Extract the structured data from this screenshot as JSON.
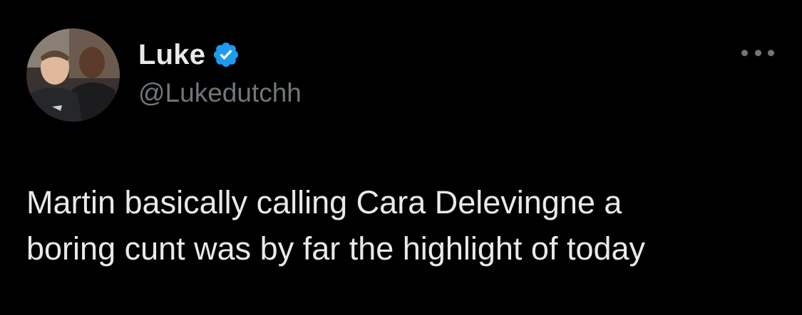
{
  "tweet": {
    "author": {
      "display_name": "Luke",
      "handle": "@Lukedutchh",
      "verified": true,
      "verified_icon": "verified-badge-icon",
      "avatar": "profile-photo"
    },
    "text": "Martin basically calling Cara Delevingne a\nboring cunt was by far the highlight of today",
    "more_icon": "more-options-icon"
  },
  "colors": {
    "background": "#000000",
    "primary_text": "#e7e9ea",
    "secondary_text": "#71767b",
    "verified_blue": "#1d9bf0"
  }
}
